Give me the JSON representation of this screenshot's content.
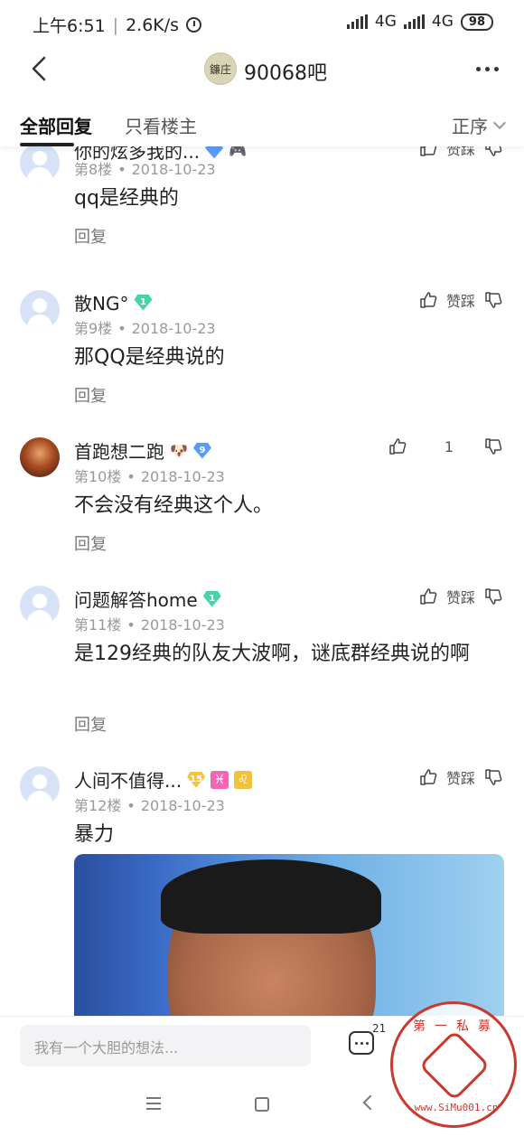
{
  "status_bar": {
    "time": "上午6:51",
    "speed": "2.6K/s",
    "network_1": "4G",
    "network_2": "4G",
    "battery": "98"
  },
  "header": {
    "forum_name": "90068吧",
    "forum_avatar_text": "鐮庄"
  },
  "tabs": {
    "all": "全部回复",
    "owner_only": "只看楼主",
    "sort": "正序"
  },
  "replies": [
    {
      "username": "你的炫多我的...",
      "floor": "第8楼",
      "date": "2018-10-23",
      "text": "qq是经典的",
      "reply_label": "回复",
      "vote": "赞踩"
    },
    {
      "username": "散NG°",
      "badge_level": "1",
      "floor": "第9楼",
      "date": "2018-10-23",
      "text": "那QQ是经典说的",
      "reply_label": "回复",
      "vote": "赞踩"
    },
    {
      "username": "首跑想二跑",
      "badge_level": "9",
      "emoji": "🐶",
      "floor": "第10楼",
      "date": "2018-10-23",
      "text": "不会没有经典这个人。",
      "reply_label": "回复",
      "vote": "1"
    },
    {
      "username": "问题解答home",
      "badge_level": "1",
      "floor": "第11楼",
      "date": "2018-10-23",
      "text": "是129经典的队友大波啊，谜底群经典说的啊",
      "reply_label": "回复",
      "vote": "赞踩"
    },
    {
      "username": "人间不值得...",
      "badge_level": "15",
      "zodiac_1": "♓",
      "zodiac_2": "♌",
      "floor": "第12楼",
      "date": "2018-10-23",
      "text": "暴力",
      "vote": "赞踩"
    }
  ],
  "bottom_bar": {
    "input_placeholder": "我有一个大胆的想法...",
    "comment_count": "21"
  },
  "watermark": {
    "top_text": "第一私募",
    "url_text": "www.SiMu001.cn"
  },
  "colors": {
    "accent": "#222222",
    "badge_green": "#48d4a8",
    "badge_blue": "#5a9cf5",
    "badge_gold": "#f5c23c",
    "watermark_red": "#c83a2e"
  }
}
